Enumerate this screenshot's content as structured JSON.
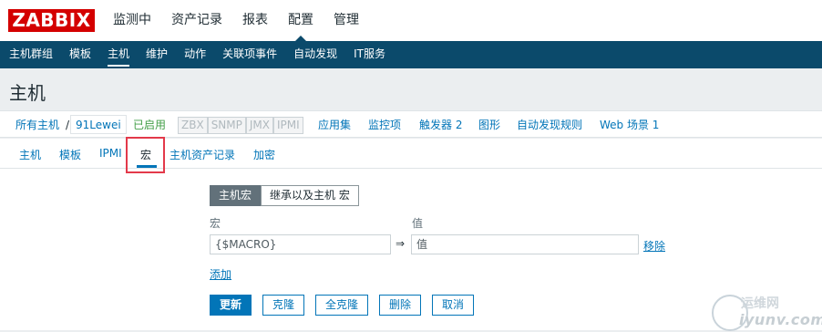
{
  "brand": {
    "logo_text": "ZABBIX",
    "color": "#d40000"
  },
  "top_menu": [
    {
      "label": "监测中",
      "active": false
    },
    {
      "label": "资产记录",
      "active": false
    },
    {
      "label": "报表",
      "active": false
    },
    {
      "label": "配置",
      "active": true
    },
    {
      "label": "管理",
      "active": false
    }
  ],
  "sub_menu": [
    {
      "label": "主机群组",
      "active": false
    },
    {
      "label": "模板",
      "active": false
    },
    {
      "label": "主机",
      "active": true
    },
    {
      "label": "维护",
      "active": false
    },
    {
      "label": "动作",
      "active": false
    },
    {
      "label": "关联项事件",
      "active": false
    },
    {
      "label": "自动发现",
      "active": false
    },
    {
      "label": "IT服务",
      "active": false
    }
  ],
  "page_title": "主机",
  "host_nav": {
    "all_hosts": "所有主机",
    "separator": "/",
    "host_name": "91Lewei",
    "status": "已启用",
    "availability": [
      "ZBX",
      "SNMP",
      "JMX",
      "IPMI"
    ],
    "applications": "应用集",
    "items": "监控项",
    "triggers": "触发器 2",
    "graphs": "图形",
    "discovery_rules": "自动发现规则",
    "web_scenarios": "Web 场景 1"
  },
  "tabs": [
    {
      "label": "主机",
      "active": false
    },
    {
      "label": "模板",
      "active": false
    },
    {
      "label": "IPMI",
      "active": false
    },
    {
      "label": "宏",
      "active": true
    },
    {
      "label": "主机资产记录",
      "active": false
    },
    {
      "label": "加密",
      "active": false
    }
  ],
  "macros": {
    "toggle": {
      "host_macros": "主机宏",
      "inherited": "继承以及主机 宏"
    },
    "col_macro": "宏",
    "col_value": "值",
    "macro_placeholder": "{$MACRO}",
    "value_placeholder": "值",
    "arrow": "⇒",
    "remove": "移除",
    "add": "添加"
  },
  "buttons": {
    "update": "更新",
    "clone": "克隆",
    "full_clone": "全克隆",
    "delete": "删除",
    "cancel": "取消"
  },
  "watermark": {
    "line1": "运维网",
    "line2": "iyunv.com"
  },
  "colors": {
    "nav_dark": "#0b4a6b",
    "link": "#0275b8",
    "enabled": "#429e47",
    "highlight_box": "#e3394a"
  }
}
